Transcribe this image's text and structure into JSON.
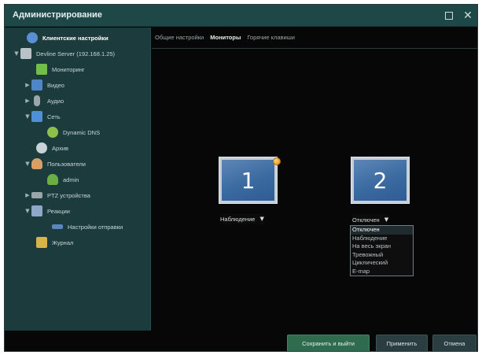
{
  "window": {
    "title": "Администрирование",
    "maximize_icon": "maximize-icon",
    "close_icon": "close-icon",
    "close_glyph": "✕"
  },
  "sidebar": {
    "items": [
      {
        "label": "Клиентские настройки",
        "icon": "gear-icon",
        "arrow": "",
        "color": "#5a8fd6"
      },
      {
        "label": "Devline Server (192.168.1.25)",
        "icon": "server-icon",
        "arrow": "▼",
        "color": "#b9c2c6"
      },
      {
        "label": "Мониторинг",
        "icon": "monitoring-icon",
        "arrow": "",
        "color": "#6fbf4a"
      },
      {
        "label": "Видео",
        "icon": "video-icon",
        "arrow": "▶",
        "color": "#4e86c8"
      },
      {
        "label": "Аудио",
        "icon": "microphone-icon",
        "arrow": "▶",
        "color": "#9aa6aa"
      },
      {
        "label": "Сеть",
        "icon": "network-icon",
        "arrow": "▼",
        "color": "#4f8fd8"
      },
      {
        "label": "Dynamic DNS",
        "icon": "globe-icon",
        "arrow": "",
        "color": "#8cc04a"
      },
      {
        "label": "Архив",
        "icon": "archive-icon",
        "arrow": "",
        "color": "#c9d2d6"
      },
      {
        "label": "Пользователи",
        "icon": "users-icon",
        "arrow": "▼",
        "color": "#d9a066"
      },
      {
        "label": "admin",
        "icon": "user-icon",
        "arrow": "",
        "color": "#6cae44"
      },
      {
        "label": "PTZ устройства",
        "icon": "ptz-camera-icon",
        "arrow": "▶",
        "color": "#9aa6aa"
      },
      {
        "label": "Реакции",
        "icon": "reactions-icon",
        "arrow": "▼",
        "color": "#8fa8c8"
      },
      {
        "label": "Настройки отправки",
        "icon": "send-settings-icon",
        "arrow": "",
        "color": "#5a86c0"
      },
      {
        "label": "Журнал",
        "icon": "journal-icon",
        "arrow": "",
        "color": "#d8b448"
      }
    ]
  },
  "tabs": [
    {
      "label": "Общие настройки"
    },
    {
      "label": "Мониторы"
    },
    {
      "label": "Горячие клавиши"
    }
  ],
  "monitors": [
    {
      "number": "1",
      "mode": "Наблюдение",
      "badge_icon": "warning-badge-icon"
    },
    {
      "number": "2",
      "mode": "Отключен"
    }
  ],
  "dropdown": {
    "caret": "▼",
    "options": [
      "Отключен",
      "Наблюдение",
      "На весь экран",
      "Тревожный",
      "Циклический",
      "E-map"
    ],
    "selected": "Отключен"
  },
  "footer": {
    "save_label": "Сохранить и выйти",
    "apply_label": "Применить",
    "cancel_label": "Отмена"
  }
}
